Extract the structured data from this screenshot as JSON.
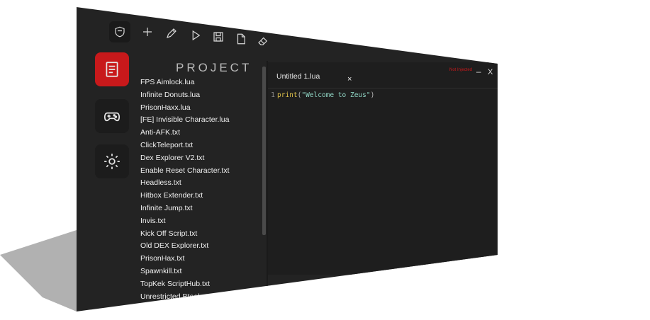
{
  "toolbar": {
    "icons": [
      "shield-icon",
      "plus-icon",
      "pen-icon",
      "play-icon",
      "save-icon",
      "file-icon",
      "eraser-icon"
    ]
  },
  "sidebar": {
    "items": [
      {
        "icon": "document-icon",
        "active": true
      },
      {
        "icon": "gamepad-icon",
        "active": false
      },
      {
        "icon": "gear-icon",
        "active": false
      }
    ]
  },
  "project": {
    "title": "PROJECT",
    "files": [
      "FPS Aimlock.lua",
      "Infinite Donuts.lua",
      "PrisonHaxx.lua",
      "[FE] Invisible Character.lua",
      "Anti-AFK.txt",
      "ClickTeleport.txt",
      "Dex Explorer V2.txt",
      "Enable Reset Character.txt",
      "Headless.txt",
      "Hitbox Extender.txt",
      "Infinite Jump.txt",
      "Invis.txt",
      "Kick Off Script.txt",
      "Old DEX Explorer.txt",
      "PrisonHax.txt",
      "Spawnkill.txt",
      "TopKek ScriptHub.txt",
      "Unrestricted Btools.txt"
    ]
  },
  "editor": {
    "tab_label": "Untitled 1.lua",
    "tab_close": "×",
    "line_number": "1",
    "code": {
      "keyword": "print",
      "open": "(",
      "string": "\"Welcome to Zeus\"",
      "close": ")"
    }
  },
  "window": {
    "title_small": "Not Injected",
    "minimize": "–",
    "close": "X"
  },
  "colors": {
    "accent": "#c8191b",
    "background": "#232323",
    "editor_bg": "#1e1e1e",
    "keyword": "#e0c24a",
    "string": "#8fd4c3"
  }
}
